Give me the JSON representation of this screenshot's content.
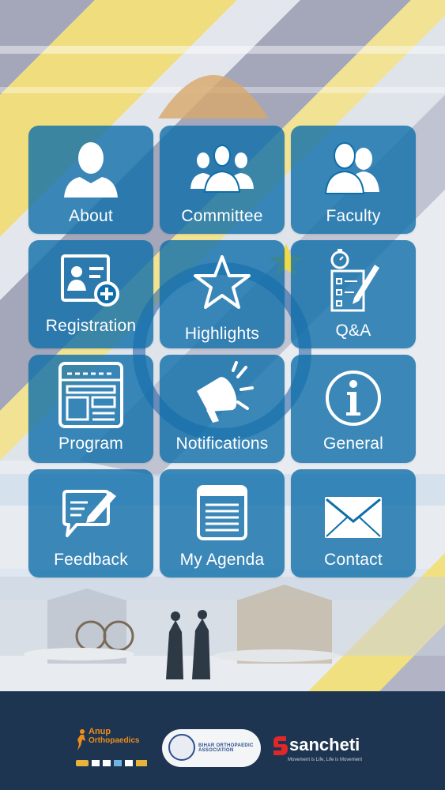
{
  "menu": {
    "tiles": [
      {
        "label": "About",
        "icon": "person-icon"
      },
      {
        "label": "Committee",
        "icon": "group-icon"
      },
      {
        "label": "Faculty",
        "icon": "two-people-icon"
      },
      {
        "label": "Registration",
        "icon": "id-card-add-icon"
      },
      {
        "label": "Highlights",
        "icon": "star-icon"
      },
      {
        "label": "Q&A",
        "icon": "stopwatch-checklist-icon"
      },
      {
        "label": "Program",
        "icon": "document-layout-icon"
      },
      {
        "label": "Notifications",
        "icon": "megaphone-icon"
      },
      {
        "label": "General",
        "icon": "info-icon"
      },
      {
        "label": "Feedback",
        "icon": "chat-edit-icon"
      },
      {
        "label": "My Agenda",
        "icon": "notepad-icon"
      },
      {
        "label": "Contact",
        "icon": "envelope-icon"
      }
    ],
    "tile_color": "#0e6eaa"
  },
  "footer": {
    "background": "#1d3550",
    "logos": {
      "anup_line1": "Anup",
      "anup_line2": "Orthopaedics",
      "boa_text": "BIHAR ORTHOPAEDIC ASSOCIATION",
      "sancheti_name": "sancheti",
      "sancheti_tagline": "Movement is Life, Life is Movement"
    }
  }
}
